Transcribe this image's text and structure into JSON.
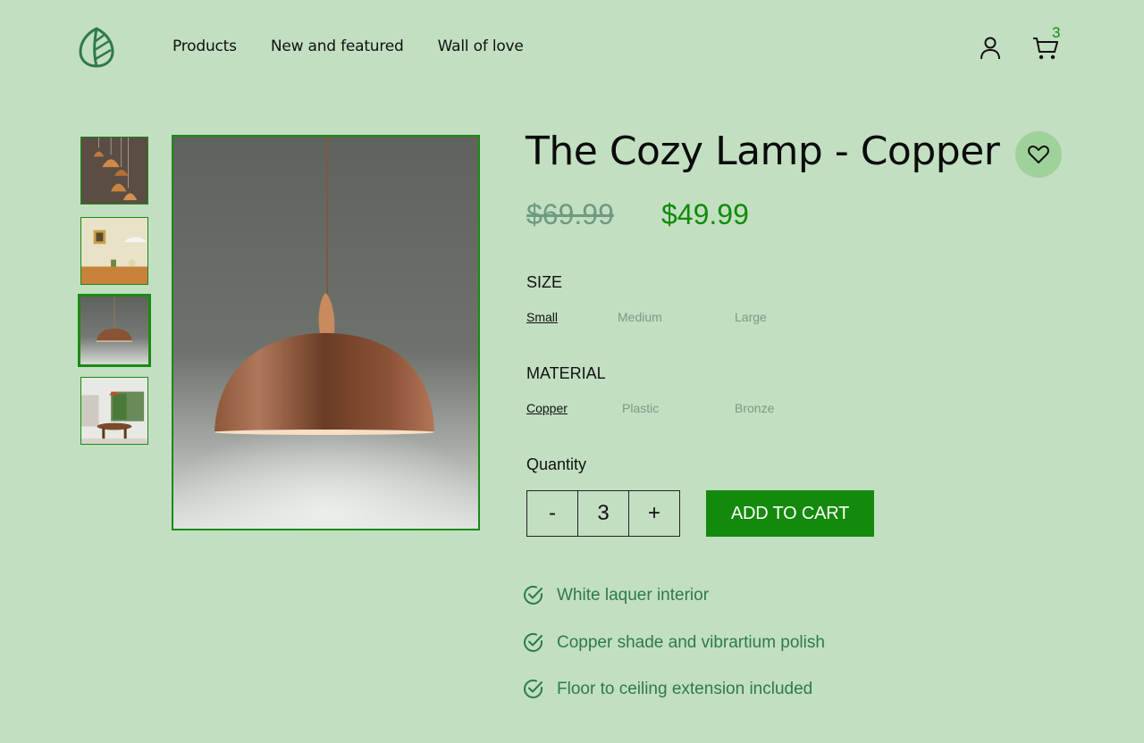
{
  "header": {
    "logo_icon": "leaf-icon",
    "nav": [
      "Products",
      "New and featured",
      "Wall of love"
    ],
    "user_icon": "user-icon",
    "cart_icon": "cart-icon",
    "cart_count": "3"
  },
  "gallery": {
    "thumbnails": [
      "pendant-cluster",
      "wall-lamp-room",
      "copper-dome-lamp",
      "dining-room"
    ],
    "selected_index": 2
  },
  "product": {
    "title": "The Cozy Lamp - Copper",
    "old_price": "$69.99",
    "price": "$49.99",
    "favorite_icon": "heart-icon",
    "size": {
      "label": "SIZE",
      "options": [
        "Small",
        "Medium",
        "Large"
      ],
      "selected": "Small"
    },
    "material": {
      "label": "MATERIAL",
      "options": [
        "Copper",
        "Plastic",
        "Bronze"
      ],
      "selected": "Copper"
    },
    "quantity": {
      "label": "Quantity",
      "minus": "-",
      "value": "3",
      "plus": "+"
    },
    "add_to_cart": "ADD TO CART",
    "features": [
      "White laquer interior",
      "Copper shade and vibrartium polish",
      "Floor to ceiling extension included"
    ]
  },
  "colors": {
    "accent": "#138a0b",
    "background": "#c2dfc2",
    "feature_text": "#2e7a4d"
  }
}
